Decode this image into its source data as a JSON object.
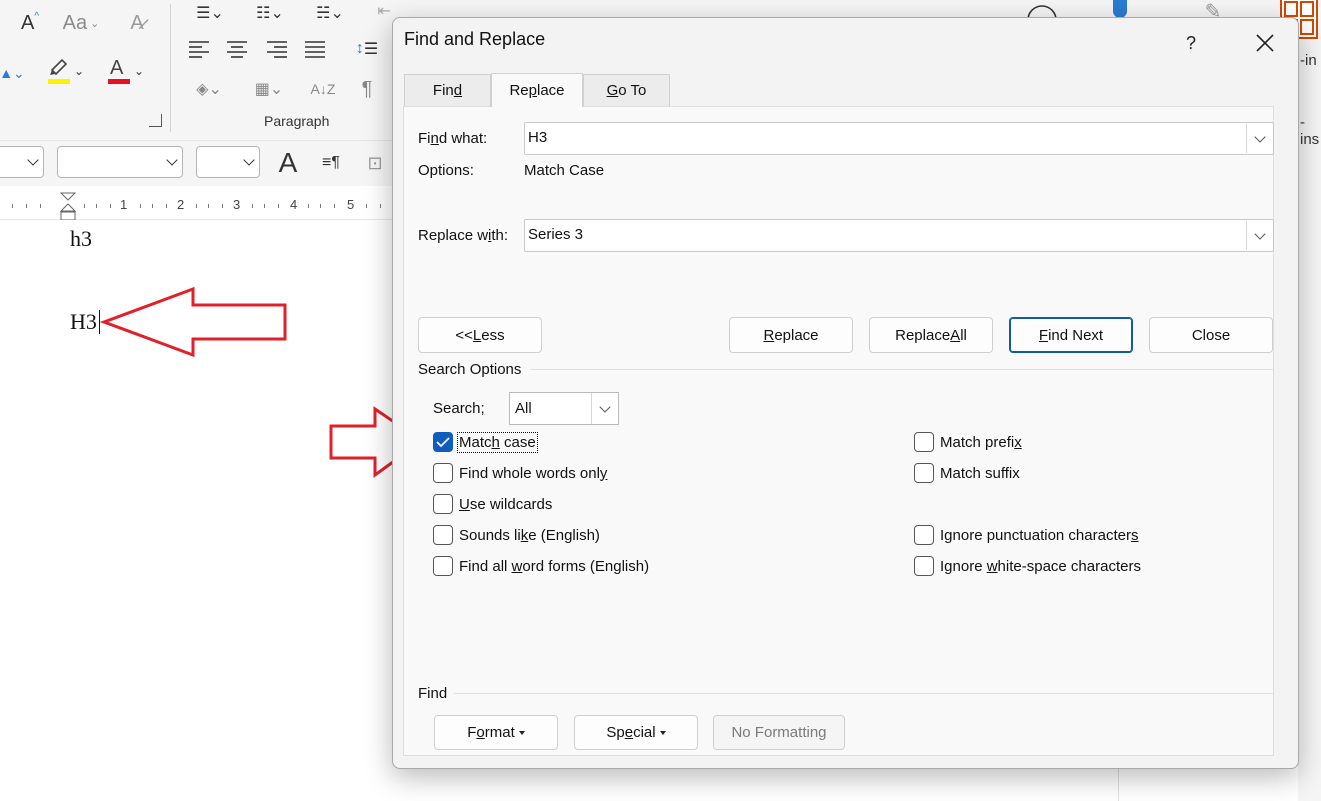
{
  "ribbon": {
    "paragraph_group_label": "Paragraph",
    "font_size_glyph": "A",
    "clear_format_glyph": "Aa",
    "big_font_glyph": "A",
    "pilcrow_glyph": "¶",
    "highlight_color": "#fff200",
    "font_color": "#e81123"
  },
  "ruler": {
    "numbers": [
      "1",
      "2",
      "3",
      "4",
      "5"
    ]
  },
  "document": {
    "line1": "h3",
    "line2": "H3"
  },
  "right_pane": {
    "text1": "-in",
    "text2": "-ins"
  },
  "dialog": {
    "title": "Find and Replace",
    "help": "?",
    "tabs": [
      {
        "pre": "Fin",
        "u": "d",
        "post": ""
      },
      {
        "pre": "Re",
        "u": "p",
        "post": "lace"
      },
      {
        "pre": "",
        "u": "G",
        "post": "o To"
      }
    ],
    "find_what_label": {
      "pre": "Fi",
      "u": "n",
      "post": "d what:"
    },
    "find_what_value": "H3",
    "options_label": "Options:",
    "options_value": "Match Case",
    "replace_with_label": {
      "pre": "Replace w",
      "u": "i",
      "post": "th:"
    },
    "replace_with_value": "Series 3",
    "buttons": {
      "less": {
        "pre": "<< ",
        "u": "L",
        "post": "ess"
      },
      "replace": {
        "pre": "",
        "u": "R",
        "post": "eplace"
      },
      "replace_all": {
        "pre": "Replace ",
        "u": "A",
        "post": "ll"
      },
      "find_next": {
        "pre": "",
        "u": "F",
        "post": "ind Next"
      },
      "close": "Close"
    },
    "search_options_heading": "Search Options",
    "search_label": {
      "pre": "Search",
      "u": ";",
      "post": ""
    },
    "search_value": "All",
    "checkboxes_left": [
      {
        "pre": "Matc",
        "u": "h",
        "post": " case",
        "checked": true
      },
      {
        "pre": "Find whole words onl",
        "u": "y",
        "post": "",
        "checked": false
      },
      {
        "pre": "",
        "u": "U",
        "post": "se wildcards",
        "checked": false
      },
      {
        "pre": "Sounds li",
        "u": "k",
        "post": "e (English)",
        "checked": false
      },
      {
        "pre": "Find all ",
        "u": "w",
        "post": "ord forms (English)",
        "checked": false
      }
    ],
    "checkboxes_right": [
      {
        "pre": "Match prefi",
        "u": "x",
        "post": "",
        "checked": false
      },
      {
        "pre": "Match suffix",
        "u": "",
        "post": "",
        "checked": false
      },
      {
        "pre": "Ignore punctuation character",
        "u": "s",
        "post": "",
        "checked": false
      },
      {
        "pre": "Ignore ",
        "u": "w",
        "post": "hite-space characters",
        "checked": false
      }
    ],
    "find_section_heading": "Find",
    "format_button": {
      "pre": "F",
      "u": "o",
      "post": "rmat"
    },
    "special_button": {
      "pre": "Sp",
      "u": "e",
      "post": "cial"
    },
    "no_formatting_button": "No Formatting"
  },
  "annotations": {
    "arrow_color": "#e0202a"
  }
}
